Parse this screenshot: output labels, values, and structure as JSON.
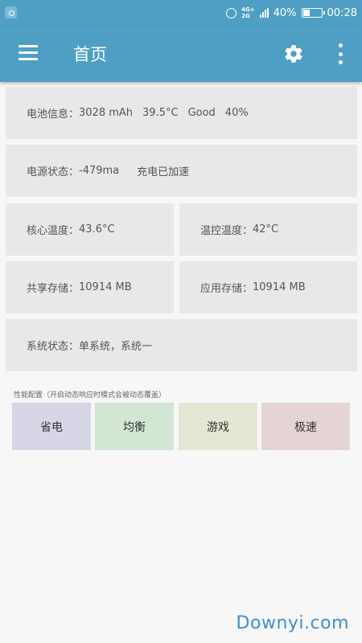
{
  "status_bar": {
    "network_label": "4G+",
    "network_sub": "2G",
    "battery": "40%",
    "battery_level": 0.4,
    "time": "00:28"
  },
  "app_bar": {
    "title": "首页"
  },
  "cards": {
    "battery": {
      "label": "电池信息：",
      "capacity": "3028 mAh",
      "temperature": "39.5°C",
      "health": "Good",
      "level": "40%"
    },
    "power": {
      "label": "电源状态：",
      "current": "-479ma",
      "charge_status": "充电已加速"
    },
    "core_temp": {
      "label": "核心温度：",
      "value": "43.6°C"
    },
    "thermal_temp": {
      "label": "温控温度：",
      "value": "42°C"
    },
    "shared_storage": {
      "label": "共享存储：",
      "value": "10914 MB"
    },
    "app_storage": {
      "label": "应用存储：",
      "value": "10914 MB"
    },
    "system": {
      "label": "系统状态：",
      "value": "单系统，系统一"
    }
  },
  "performance": {
    "label": "性能配置（开启动态响应时模式会被动态覆盖）",
    "modes": [
      {
        "label": "省电",
        "color": "#d6d6e6"
      },
      {
        "label": "均衡",
        "color": "#d3e6d4"
      },
      {
        "label": "游戏",
        "color": "#e5e6d3"
      },
      {
        "label": "极速",
        "color": "#e6d3d3"
      }
    ]
  },
  "watermark": "Downyi.com"
}
